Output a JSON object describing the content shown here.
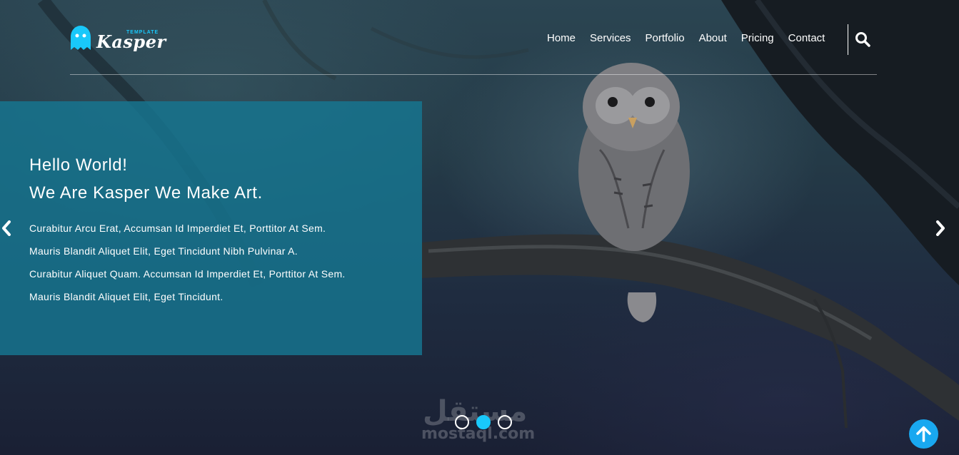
{
  "brand": {
    "name": "Kasper",
    "tagline": "TEMPLATE",
    "accent": "#19c8fa"
  },
  "nav": {
    "items": [
      {
        "label": "Home"
      },
      {
        "label": "Services"
      },
      {
        "label": "Portfolio"
      },
      {
        "label": "About"
      },
      {
        "label": "Pricing"
      },
      {
        "label": "Contact"
      }
    ],
    "search_icon": "search-icon"
  },
  "hero": {
    "title_line1": "Hello World!",
    "title_line2": "We Are Kasper We Make Art.",
    "paragraph_lines": [
      "Curabitur Arcu Erat, Accumsan Id Imperdiet Et, Porttitor At Sem.",
      "Mauris Blandit Aliquet Elit, Eget Tincidunt Nibh Pulvinar A.",
      "Curabitur Aliquet Quam. Accumsan Id Imperdiet Et, Porttitor At Sem.",
      "Mauris Blandit Aliquet Elit, Eget Tincidunt."
    ],
    "panel_color": "#167691"
  },
  "slider": {
    "prev_icon": "chevron-left-icon",
    "next_icon": "chevron-right-icon",
    "slide_count": 3,
    "active_index": 1
  },
  "watermark": {
    "arabic": "مستقل",
    "latin": "mostaql.com"
  },
  "scroll_top": {
    "icon": "arrow-up-icon",
    "color": "#19a8f0"
  }
}
